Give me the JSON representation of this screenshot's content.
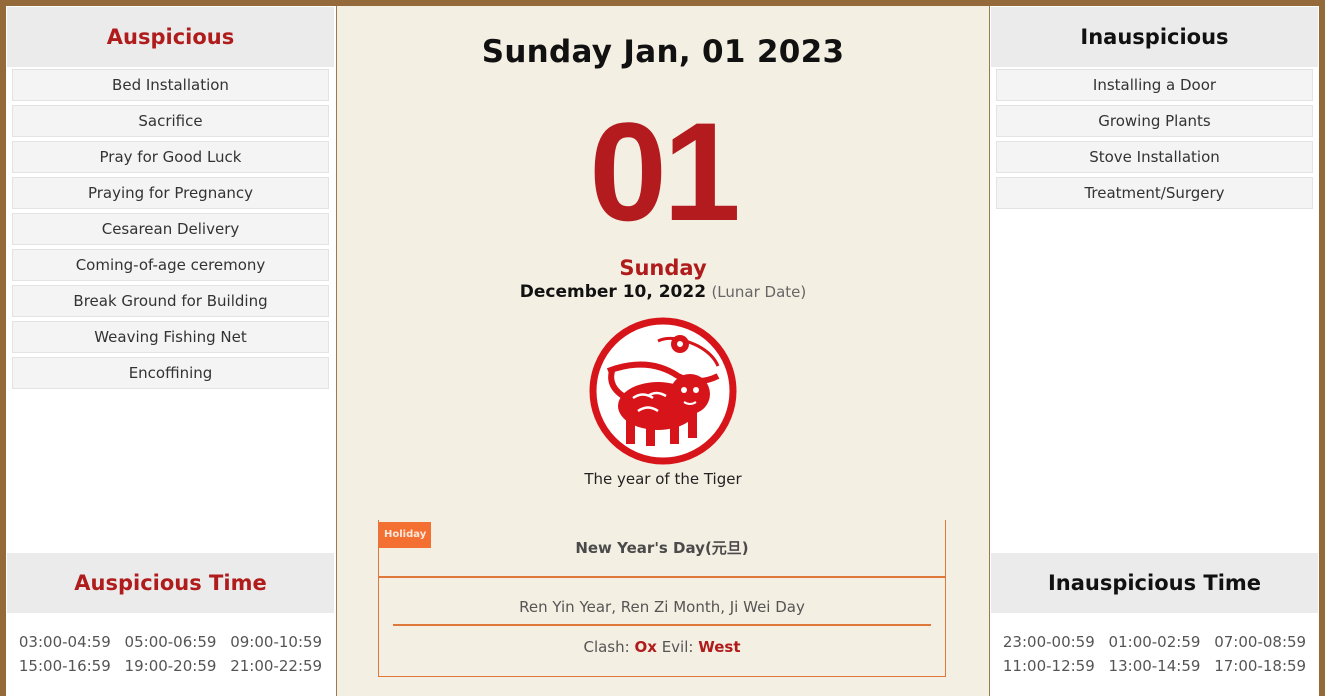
{
  "auspicious": {
    "title": "Auspicious",
    "items": [
      "Bed Installation",
      "Sacrifice",
      "Pray for Good Luck",
      "Praying for Pregnancy",
      "Cesarean Delivery",
      "Coming-of-age ceremony",
      "Break Ground for Building",
      "Weaving Fishing Net",
      "Encoffining"
    ]
  },
  "inauspicious": {
    "title": "Inauspicious",
    "items": [
      "Installing a Door",
      "Growing Plants",
      "Stove Installation",
      "Treatment/Surgery"
    ]
  },
  "auspicious_time": {
    "title": "Auspicious Time",
    "times": [
      "03:00-04:59",
      "05:00-06:59",
      "09:00-10:59",
      "15:00-16:59",
      "19:00-20:59",
      "21:00-22:59"
    ]
  },
  "inauspicious_time": {
    "title": "Inauspicious Time",
    "times": [
      "23:00-00:59",
      "01:00-02:59",
      "07:00-08:59",
      "11:00-12:59",
      "13:00-14:59",
      "17:00-18:59"
    ]
  },
  "center": {
    "title_date": "Sunday Jan, 01 2023",
    "day_number": "01",
    "weekday": "Sunday",
    "lunar_date": "December 10, 2022",
    "lunar_label": "(Lunar Date)",
    "zodiac_icon": "tiger-papercut-icon",
    "zodiac_caption": "The year of the Tiger",
    "holiday_tag": "Holiday",
    "holiday_name": "New Year's Day(元旦)",
    "ganzhi": "Ren Yin Year, Ren Zi Month, Ji Wei Day",
    "clash_label": "Clash:",
    "clash_value": "Ox",
    "evil_label": "Evil:",
    "evil_value": "West"
  },
  "colors": {
    "accent_red": "#b01c1c",
    "frame_brown": "#946a3a",
    "holiday_orange": "#f37032"
  }
}
